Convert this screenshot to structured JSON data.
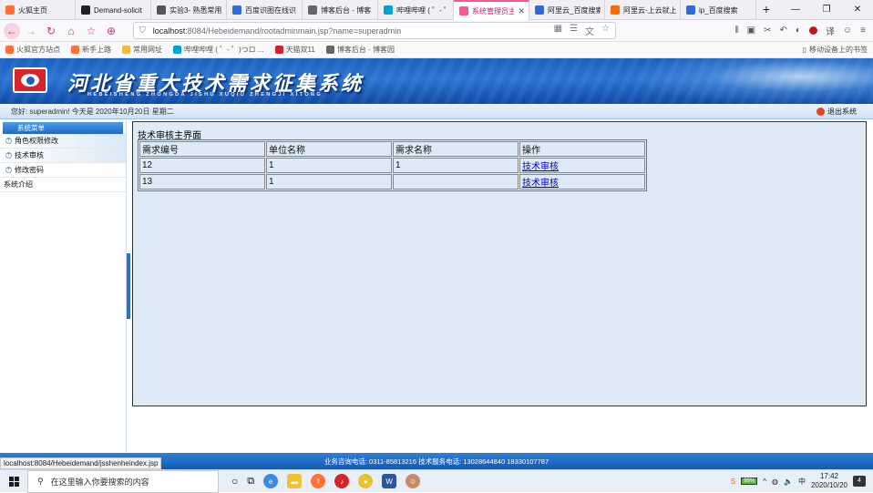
{
  "browser": {
    "tabs": [
      {
        "label": "火狐主页",
        "icon": "firefox-icon",
        "color": "#ff7139",
        "active": false
      },
      {
        "label": "Demand-solicit",
        "icon": "github-icon",
        "color": "#222222",
        "active": false
      },
      {
        "label": "实验3- 熟悉常用",
        "icon": "experiment-icon",
        "color": "#555555",
        "active": false
      },
      {
        "label": "百度识图在线识",
        "icon": "baidu-icon",
        "color": "#2f6bd8",
        "active": false
      },
      {
        "label": "博客后台 - 博客",
        "icon": "blog-icon",
        "color": "#666666",
        "active": false
      },
      {
        "label": "哔哩哔哩 ( ゜- ゜",
        "icon": "bilibili-icon",
        "color": "#00a1d6",
        "active": false
      },
      {
        "label": "系统管理员主页面",
        "icon": "page-icon",
        "color": "#f25a8f",
        "active": true
      },
      {
        "label": "阿里云_百度搜索",
        "icon": "baidu-icon",
        "color": "#2f6bd8",
        "active": false
      },
      {
        "label": "阿里云-上云就上",
        "icon": "aliyun-icon",
        "color": "#ff6a00",
        "active": false
      },
      {
        "label": "ip_百度搜索",
        "icon": "baidu-icon",
        "color": "#2f6bd8",
        "active": false
      }
    ],
    "url_host": "localhost",
    "url_rest": ":8084/Hebeidemand/rootadminmain.jsp?name=superadmin",
    "bookmarks": [
      {
        "label": "火狐官方站点",
        "icon": "firefox-icon",
        "color": "#ff7139"
      },
      {
        "label": "新手上路",
        "icon": "firefox-icon",
        "color": "#ff7139"
      },
      {
        "label": "常用网址",
        "icon": "folder-icon",
        "color": "#f5b642"
      },
      {
        "label": "哔哩哔哩 ( ゜- ゜)つロ ...",
        "icon": "bilibili-icon",
        "color": "#00a1d6"
      },
      {
        "label": "天猫双11",
        "icon": "tmall-icon",
        "color": "#d8222b"
      },
      {
        "label": "博客后台 - 博客园",
        "icon": "blog-icon",
        "color": "#666666"
      }
    ],
    "mobile_bookmarks": "移动设备上的书签"
  },
  "site": {
    "title": "河北省重大技术需求征集系统",
    "pinyin": "HEBEISHENG ZHONGDA JISHU XUQIU ZHENGJI XITONG",
    "greeting": "您好: superadmin!  今天是 2020年10月20日 星期二",
    "logout": "退出系统"
  },
  "menu": {
    "header": "系统菜单",
    "items": [
      "角色权限修改",
      "技术审核",
      "修改密码"
    ],
    "intro": "系统介绍"
  },
  "main": {
    "title": "技术审核主界面",
    "columns": [
      "需求编号",
      "单位名称",
      "需求名称",
      "操作"
    ],
    "rows": [
      {
        "id": "12",
        "unit": "1",
        "name": "1",
        "action": "技术审核"
      },
      {
        "id": "13",
        "unit": "1",
        "name": "",
        "action": "技术审核"
      }
    ]
  },
  "footer": {
    "contact": "业务咨询电话: 0311-85813216 技术服务电话: 13028644840 18330107787",
    "status_url": "localhost:8084/Hebeidemand/jsshenheindex.jsp"
  },
  "taskbar": {
    "search_placeholder": "在这里输入你要搜索的内容",
    "battery": "99%",
    "time": "17:42",
    "date": "2020/10/20",
    "notifications": "4"
  },
  "colors": {
    "banner": "#1a5fbf",
    "active_tab": "#c0216c",
    "panel_bg": "#dfeaf7",
    "link": "#0000cc"
  }
}
